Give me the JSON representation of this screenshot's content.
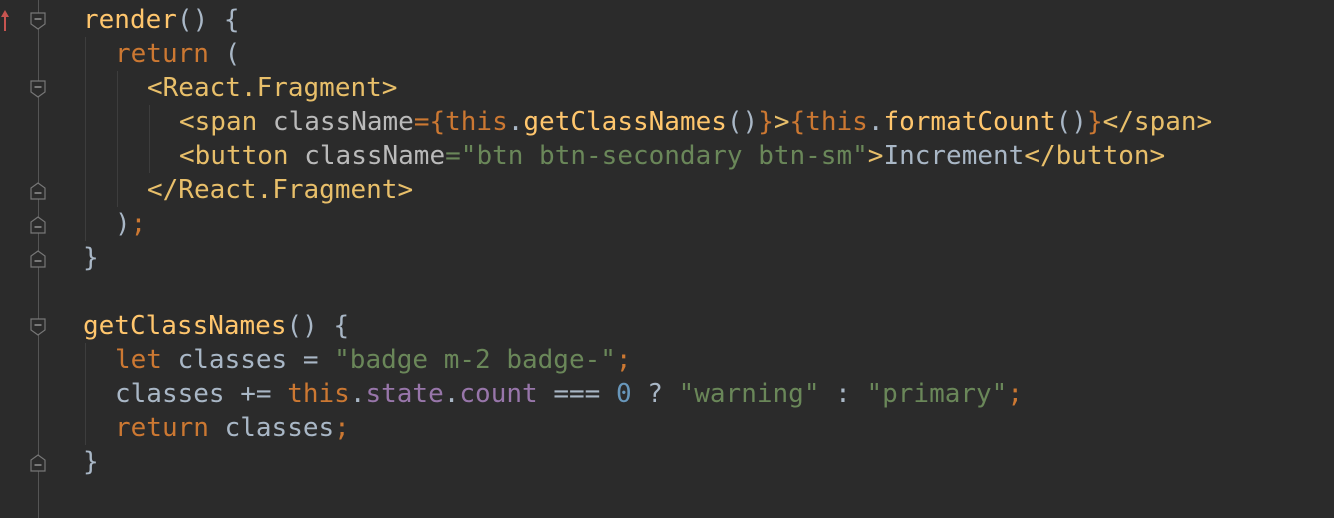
{
  "editor": {
    "lines": [
      {
        "tokens": [
          {
            "t": "render",
            "c": "fn"
          },
          {
            "t": "() {",
            "c": "txt"
          }
        ]
      },
      {
        "tokens": [
          {
            "t": "return",
            "c": "kw"
          },
          {
            "t": " (",
            "c": "txt"
          }
        ]
      },
      {
        "tokens": [
          {
            "t": "<React.Fragment>",
            "c": "tag"
          }
        ]
      },
      {
        "tokens": [
          {
            "t": "<span ",
            "c": "tag"
          },
          {
            "t": "className",
            "c": "attr"
          },
          {
            "t": "={",
            "c": "kw"
          },
          {
            "t": "this",
            "c": "kw"
          },
          {
            "t": ".",
            "c": "txt"
          },
          {
            "t": "getClassNames",
            "c": "fn"
          },
          {
            "t": "()",
            "c": "txt"
          },
          {
            "t": "}",
            "c": "kw"
          },
          {
            "t": ">",
            "c": "tag"
          },
          {
            "t": "{",
            "c": "kw"
          },
          {
            "t": "this",
            "c": "kw"
          },
          {
            "t": ".",
            "c": "txt"
          },
          {
            "t": "formatCount",
            "c": "fn"
          },
          {
            "t": "()",
            "c": "txt"
          },
          {
            "t": "}",
            "c": "kw"
          },
          {
            "t": "</span>",
            "c": "tag"
          }
        ]
      },
      {
        "tokens": [
          {
            "t": "<button ",
            "c": "tag"
          },
          {
            "t": "className",
            "c": "attr"
          },
          {
            "t": "=\"",
            "c": "str"
          },
          {
            "t": "btn btn-secondary btn-sm",
            "c": "str"
          },
          {
            "t": "\"",
            "c": "str"
          },
          {
            "t": ">",
            "c": "tag"
          },
          {
            "t": "Increment",
            "c": "txt"
          },
          {
            "t": "</button>",
            "c": "tag"
          }
        ]
      },
      {
        "tokens": [
          {
            "t": "</React.Fragment>",
            "c": "tag"
          }
        ]
      },
      {
        "tokens": [
          {
            "t": ")",
            "c": "txt"
          },
          {
            "t": ";",
            "c": "kw"
          }
        ]
      },
      {
        "tokens": [
          {
            "t": "}",
            "c": "txt"
          }
        ]
      },
      {
        "tokens": []
      },
      {
        "tokens": [
          {
            "t": "getClassNames",
            "c": "fn"
          },
          {
            "t": "() {",
            "c": "txt"
          }
        ]
      },
      {
        "tokens": [
          {
            "t": "let",
            "c": "kw"
          },
          {
            "t": " classes = ",
            "c": "txt"
          },
          {
            "t": "\"badge m-2 badge-\"",
            "c": "str"
          },
          {
            "t": ";",
            "c": "kw"
          }
        ]
      },
      {
        "tokens": [
          {
            "t": "classes += ",
            "c": "txt"
          },
          {
            "t": "this",
            "c": "kw"
          },
          {
            "t": ".",
            "c": "txt"
          },
          {
            "t": "state",
            "c": "prop"
          },
          {
            "t": ".",
            "c": "txt"
          },
          {
            "t": "count",
            "c": "prop"
          },
          {
            "t": " === ",
            "c": "txt"
          },
          {
            "t": "0",
            "c": "num"
          },
          {
            "t": " ? ",
            "c": "txt"
          },
          {
            "t": "\"warning\"",
            "c": "str"
          },
          {
            "t": " : ",
            "c": "txt"
          },
          {
            "t": "\"primary\"",
            "c": "str"
          },
          {
            "t": ";",
            "c": "kw"
          }
        ]
      },
      {
        "tokens": [
          {
            "t": "return",
            "c": "kw"
          },
          {
            "t": " classes",
            "c": "txt"
          },
          {
            "t": ";",
            "c": "kw"
          }
        ]
      },
      {
        "tokens": [
          {
            "t": "}",
            "c": "txt"
          }
        ]
      }
    ]
  },
  "colors": {
    "background": "#2b2b2b",
    "keyword": "#cc7832",
    "function": "#ffc66d",
    "tag": "#e8bf6a",
    "string": "#6a8759",
    "number": "#6897bb",
    "property": "#9876aa",
    "text": "#a9b7c6",
    "override_marker": "#c75450"
  },
  "gutter": {
    "override_icon": "implements-method-arrow-icon",
    "fold_icon": "fold-toggle-icon"
  }
}
